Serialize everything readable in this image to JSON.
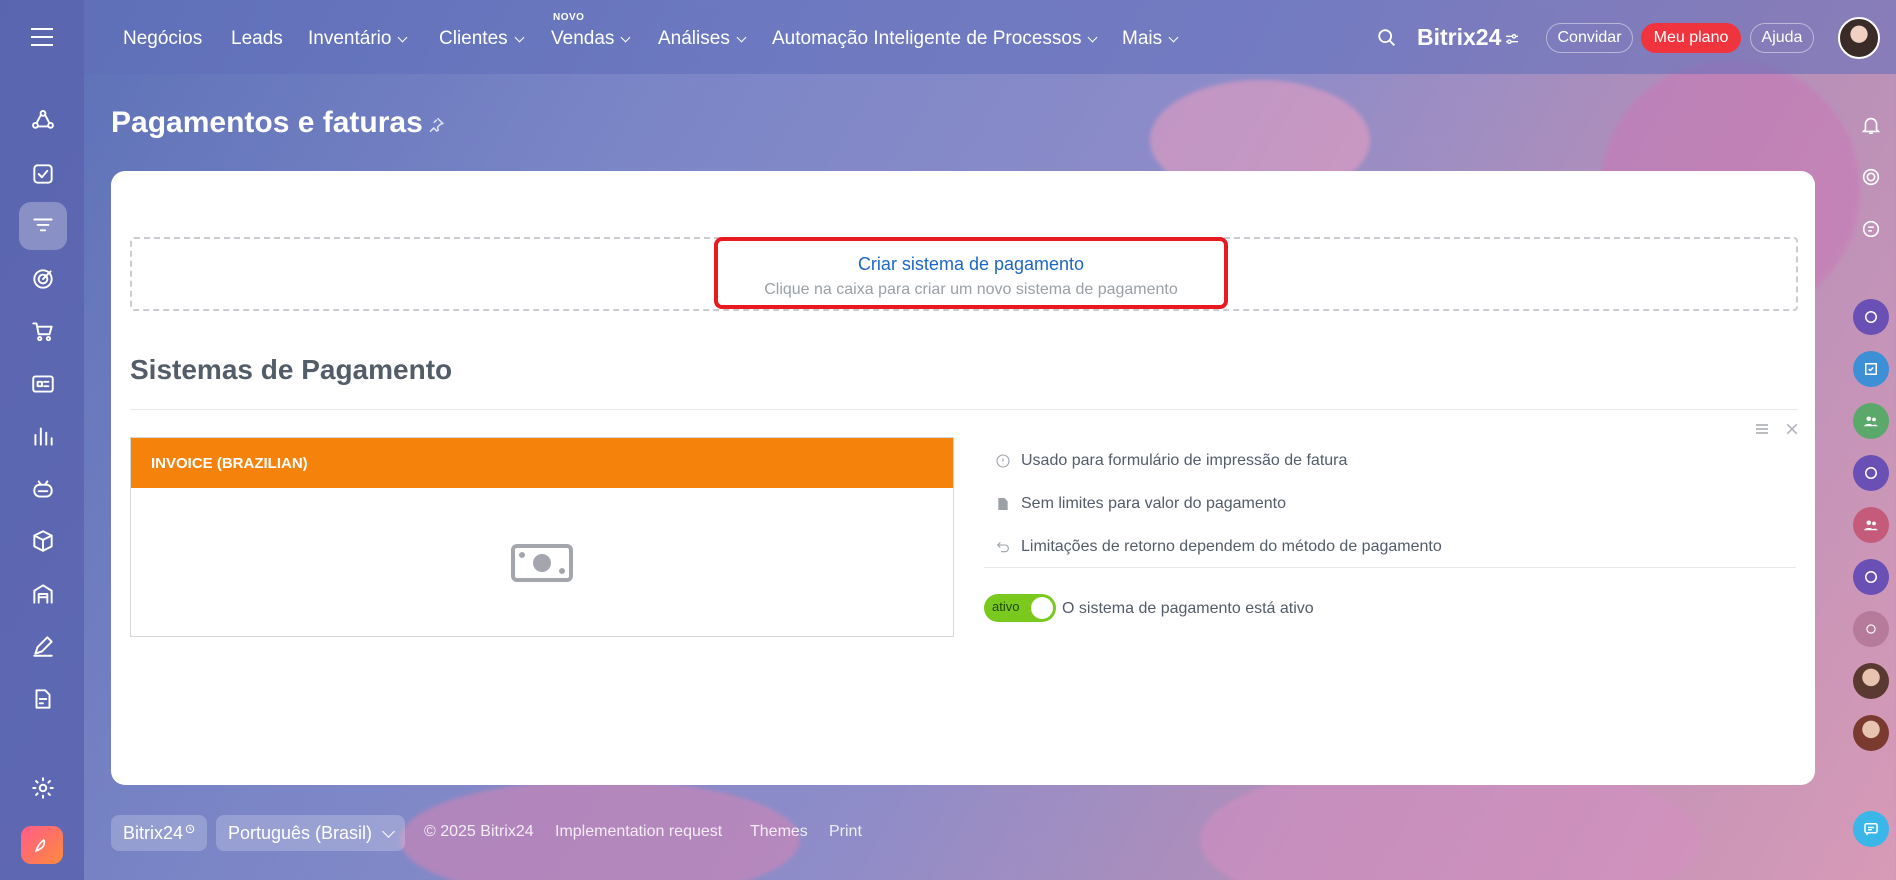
{
  "topnav": {
    "items": [
      {
        "label": "Negócios"
      },
      {
        "label": "Leads"
      },
      {
        "label": "Inventário"
      },
      {
        "label": "Clientes"
      },
      {
        "label": "Vendas"
      },
      {
        "label": "Análises"
      },
      {
        "label": "Automação Inteligente de Processos"
      },
      {
        "label": "Mais"
      }
    ],
    "novo_badge": "NOVO",
    "brand": "Bitrix24",
    "invite": "Convidar",
    "plan": "Meu plano",
    "help": "Ajuda"
  },
  "page": {
    "title": "Pagamentos e faturas"
  },
  "create": {
    "title": "Criar sistema de pagamento",
    "subtitle": "Clique na caixa para criar um novo sistema de pagamento"
  },
  "section": {
    "title": "Sistemas de Pagamento"
  },
  "payment_system": {
    "name": "INVOICE (BRAZILIAN)",
    "info": [
      {
        "icon": "info-icon",
        "text": "Usado para formulário de impressão de fatura"
      },
      {
        "icon": "document-icon",
        "text": "Sem limites para valor do pagamento"
      },
      {
        "icon": "return-icon",
        "text": "Limitações de retorno dependem do método de pagamento"
      }
    ],
    "toggle_label": "ativo",
    "status_text": "O sistema de pagamento está ativo"
  },
  "footer": {
    "brand": "Bitrix24",
    "language": "Português (Brasil)",
    "copyright": "© 2025 Bitrix24",
    "links": [
      "Implementation request",
      "Themes",
      "Print"
    ]
  },
  "colors": {
    "accent_blue": "#1e66c6",
    "orange": "#f5820b",
    "red_highlight": "#e8191f",
    "toggle_green": "#7ac91f",
    "plan_red": "#f0343e"
  }
}
